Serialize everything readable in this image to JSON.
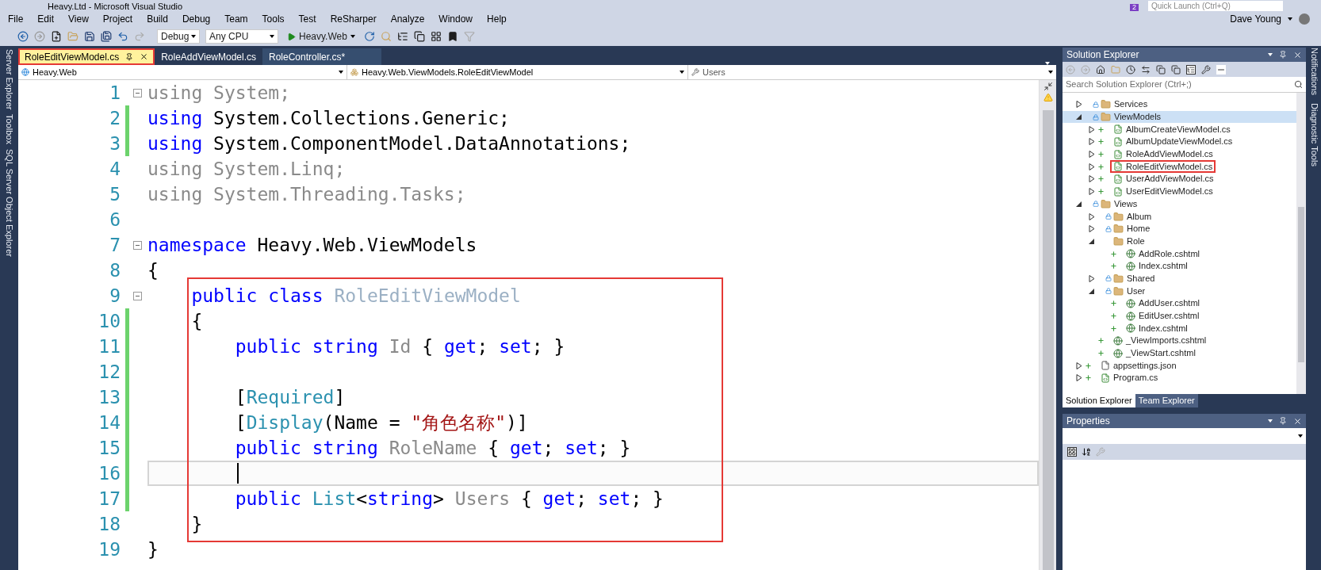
{
  "window": {
    "title": "Heavy.Ltd - Microsoft Visual Studio"
  },
  "title_bar": {
    "notification_count": "2",
    "quick_launch": {
      "placeholder": "Quick Launch (Ctrl+Q)"
    },
    "user": "Dave Young"
  },
  "menu": [
    "File",
    "Edit",
    "View",
    "Project",
    "Build",
    "Debug",
    "Team",
    "Tools",
    "Test",
    "ReSharper",
    "Analyze",
    "Window",
    "Help"
  ],
  "toolbar": {
    "configuration": "Debug",
    "platform": "Any CPU",
    "start": "Heavy.Web"
  },
  "tabs": [
    {
      "label": "RoleEditViewModel.cs",
      "selected": true,
      "boxed": true
    },
    {
      "label": "RoleAddViewModel.cs",
      "selected": false,
      "boxed": false
    },
    {
      "label": "RoleController.cs*",
      "selected": false,
      "boxed": false
    }
  ],
  "navigation_bar": {
    "project": "Heavy.Web",
    "type": "Heavy.Web.ViewModels.RoleEditViewModel",
    "member": "Users"
  },
  "left_rail": [
    "Server Explorer",
    "Toolbox",
    "SQL Server Object Explorer"
  ],
  "right_rail": [
    "Notifications",
    "Diagnostic Tools"
  ],
  "code": {
    "blocks": [
      {
        "boxed": false,
        "lines": [
          {
            "number": "1",
            "changed": false,
            "fold": true,
            "current": false,
            "tokens": [
              {
                "text": "using System;",
                "kind": "dim"
              }
            ]
          },
          {
            "number": "2",
            "changed": true,
            "fold": false,
            "current": false,
            "tokens": [
              {
                "text": "using",
                "kind": "kw"
              },
              {
                "text": " System.Collections.Generic;",
                "kind": "plain"
              }
            ]
          },
          {
            "number": "3",
            "changed": true,
            "fold": false,
            "current": false,
            "tokens": [
              {
                "text": "using",
                "kind": "kw"
              },
              {
                "text": " System.ComponentModel.DataAnnotations;",
                "kind": "plain"
              }
            ]
          },
          {
            "number": "4",
            "changed": false,
            "fold": false,
            "current": false,
            "tokens": [
              {
                "text": "using System.Linq;",
                "kind": "dim"
              }
            ]
          },
          {
            "number": "5",
            "changed": false,
            "fold": false,
            "current": false,
            "tokens": [
              {
                "text": "using System.Threading.Tasks;",
                "kind": "dim"
              }
            ]
          },
          {
            "number": "6",
            "changed": false,
            "fold": false,
            "current": false
          },
          {
            "number": "7",
            "changed": false,
            "fold": true,
            "current": false,
            "tokens": [
              {
                "text": "namespace",
                "kind": "kw"
              },
              {
                "text": " Heavy.Web.ViewModels",
                "kind": "plain"
              }
            ]
          },
          {
            "number": "8",
            "changed": false,
            "fold": false,
            "current": false,
            "tokens": [
              {
                "text": "{",
                "kind": "plain"
              }
            ]
          }
        ]
      },
      {
        "boxed": true,
        "lines": [
          {
            "number": "9",
            "changed": false,
            "fold": true,
            "current": false,
            "tokens": [
              {
                "text": "    public class",
                "kind": "kw"
              },
              {
                "text": " RoleEditViewModel",
                "kind": "dimtype"
              }
            ]
          },
          {
            "number": "10",
            "changed": true,
            "fold": false,
            "current": false,
            "tokens": [
              {
                "text": "    {",
                "kind": "plain"
              }
            ]
          },
          {
            "number": "11",
            "changed": true,
            "fold": false,
            "current": false,
            "tokens": [
              {
                "text": "        public string",
                "kind": "kw"
              },
              {
                "text": " Id",
                "kind": "dim"
              },
              {
                "text": " { ",
                "kind": "plain"
              },
              {
                "text": "get",
                "kind": "kw"
              },
              {
                "text": "; ",
                "kind": "plain"
              },
              {
                "text": "set",
                "kind": "kw"
              },
              {
                "text": "; }",
                "kind": "plain"
              }
            ]
          },
          {
            "number": "12",
            "changed": true,
            "fold": false,
            "current": false
          },
          {
            "number": "13",
            "changed": true,
            "fold": false,
            "current": false,
            "tokens": [
              {
                "text": "        [",
                "kind": "plain"
              },
              {
                "text": "Required",
                "kind": "type"
              },
              {
                "text": "]",
                "kind": "plain"
              }
            ]
          },
          {
            "number": "14",
            "changed": true,
            "fold": false,
            "current": false,
            "tokens": [
              {
                "text": "        [",
                "kind": "plain"
              },
              {
                "text": "Display",
                "kind": "type"
              },
              {
                "text": "(Name = ",
                "kind": "plain"
              },
              {
                "text": "\"角色名称\"",
                "kind": "str"
              },
              {
                "text": ")]",
                "kind": "plain"
              }
            ]
          },
          {
            "number": "15",
            "changed": true,
            "fold": false,
            "current": false,
            "tokens": [
              {
                "text": "        public string",
                "kind": "kw"
              },
              {
                "text": " RoleName",
                "kind": "dim"
              },
              {
                "text": " { ",
                "kind": "plain"
              },
              {
                "text": "get",
                "kind": "kw"
              },
              {
                "text": "; ",
                "kind": "plain"
              },
              {
                "text": "set",
                "kind": "kw"
              },
              {
                "text": "; }",
                "kind": "plain"
              }
            ]
          },
          {
            "number": "16",
            "changed": true,
            "fold": false,
            "current": true
          },
          {
            "number": "17",
            "changed": true,
            "fold": false,
            "current": false,
            "tokens": [
              {
                "text": "        public",
                "kind": "kw"
              },
              {
                "text": " List",
                "kind": "type"
              },
              {
                "text": "<",
                "kind": "plain"
              },
              {
                "text": "string",
                "kind": "kw"
              },
              {
                "text": "> ",
                "kind": "plain"
              },
              {
                "text": "Users",
                "kind": "dim"
              },
              {
                "text": " { ",
                "kind": "plain"
              },
              {
                "text": "get",
                "kind": "kw"
              },
              {
                "text": "; ",
                "kind": "plain"
              },
              {
                "text": "set",
                "kind": "kw"
              },
              {
                "text": "; }",
                "kind": "plain"
              }
            ]
          },
          {
            "number": "18",
            "changed": false,
            "fold": false,
            "current": false,
            "tokens": [
              {
                "text": "    }",
                "kind": "plain"
              }
            ]
          }
        ]
      },
      {
        "boxed": false,
        "lines": [
          {
            "number": "19",
            "changed": false,
            "fold": false,
            "current": false,
            "tokens": [
              {
                "text": "}",
                "kind": "plain"
              }
            ]
          }
        ]
      }
    ]
  },
  "solution_explorer": {
    "title": "Solution Explorer",
    "search": {
      "placeholder": "Search Solution Explorer (Ctrl+;)"
    },
    "tree": [
      {
        "label": "Services",
        "kind": "folder",
        "locked": true,
        "added": false,
        "expanded": false,
        "selected": false,
        "boxed": false
      },
      {
        "label": "ViewModels",
        "kind": "folder",
        "locked": true,
        "added": false,
        "expanded": true,
        "selected": true,
        "boxed": false,
        "children": [
          {
            "label": "AlbumCreateViewModel.cs",
            "kind": "cs",
            "locked": false,
            "added": true,
            "expanded": false,
            "selected": false,
            "boxed": false
          },
          {
            "label": "AlbumUpdateViewModel.cs",
            "kind": "cs",
            "locked": false,
            "added": true,
            "expanded": false,
            "selected": false,
            "boxed": false
          },
          {
            "label": "RoleAddViewModel.cs",
            "kind": "cs",
            "locked": false,
            "added": true,
            "expanded": false,
            "selected": false,
            "boxed": false
          },
          {
            "label": "RoleEditViewModel.cs",
            "kind": "cs",
            "locked": false,
            "added": true,
            "expanded": false,
            "selected": false,
            "boxed": true
          },
          {
            "label": "UserAddViewModel.cs",
            "kind": "cs",
            "locked": false,
            "added": true,
            "expanded": false,
            "selected": false,
            "boxed": false
          },
          {
            "label": "UserEditViewModel.cs",
            "kind": "cs",
            "locked": false,
            "added": true,
            "expanded": false,
            "selected": false,
            "boxed": false
          }
        ]
      },
      {
        "label": "Views",
        "kind": "folder",
        "locked": true,
        "added": false,
        "expanded": true,
        "selected": false,
        "boxed": false,
        "children": [
          {
            "label": "Album",
            "kind": "folder",
            "locked": true,
            "added": false,
            "expanded": false,
            "selected": false,
            "boxed": false
          },
          {
            "label": "Home",
            "kind": "folder",
            "locked": true,
            "added": false,
            "expanded": false,
            "selected": false,
            "boxed": false
          },
          {
            "label": "Role",
            "kind": "folder",
            "locked": false,
            "added": false,
            "expanded": true,
            "selected": false,
            "boxed": false,
            "children": [
              {
                "label": "AddRole.cshtml",
                "kind": "cshtml",
                "locked": false,
                "added": true,
                "selected": false,
                "boxed": false
              },
              {
                "label": "Index.cshtml",
                "kind": "cshtml",
                "locked": false,
                "added": true,
                "selected": false,
                "boxed": false
              }
            ]
          },
          {
            "label": "Shared",
            "kind": "folder",
            "locked": true,
            "added": false,
            "expanded": false,
            "selected": false,
            "boxed": false
          },
          {
            "label": "User",
            "kind": "folder",
            "locked": true,
            "added": false,
            "expanded": true,
            "selected": false,
            "boxed": false,
            "children": [
              {
                "label": "AddUser.cshtml",
                "kind": "cshtml",
                "locked": false,
                "added": true,
                "selected": false,
                "boxed": false
              },
              {
                "label": "EditUser.cshtml",
                "kind": "cshtml",
                "locked": false,
                "added": true,
                "selected": false,
                "boxed": false
              },
              {
                "label": "Index.cshtml",
                "kind": "cshtml",
                "locked": false,
                "added": true,
                "selected": false,
                "boxed": false
              }
            ]
          },
          {
            "label": "_ViewImports.cshtml",
            "kind": "cshtml",
            "locked": false,
            "added": true,
            "selected": false,
            "boxed": false
          },
          {
            "label": "_ViewStart.cshtml",
            "kind": "cshtml",
            "locked": false,
            "added": true,
            "selected": false,
            "boxed": false
          }
        ]
      },
      {
        "label": "appsettings.json",
        "kind": "json",
        "locked": false,
        "added": true,
        "expanded": false,
        "selected": false,
        "boxed": false
      },
      {
        "label": "Program.cs",
        "kind": "cs",
        "locked": false,
        "added": true,
        "expanded": false,
        "selected": false,
        "boxed": false
      }
    ],
    "bottom_tabs": [
      {
        "label": "Solution Explorer",
        "selected": true
      },
      {
        "label": "Team Explorer",
        "selected": false
      }
    ]
  },
  "properties": {
    "title": "Properties"
  }
}
